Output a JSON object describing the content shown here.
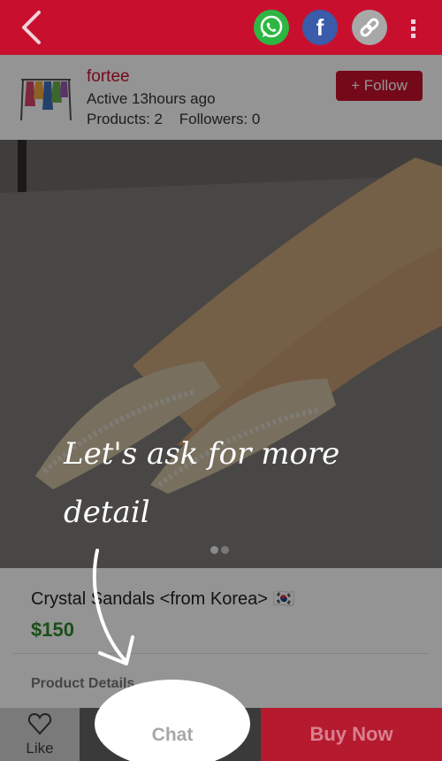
{
  "topbar": {
    "icons": [
      "back-icon",
      "whatsapp-icon",
      "facebook-icon",
      "link-icon",
      "more-vertical-icon"
    ],
    "facebook_glyph": "f"
  },
  "seller": {
    "name": "fortee",
    "active": "Active 13hours ago",
    "products": "Products: 2",
    "followers": "Followers: 0",
    "follow_label": "+ Follow"
  },
  "product": {
    "image_pages": 2,
    "current_page": 1,
    "title": "Crystal Sandals <from Korea> 🇰🇷",
    "price": "$150",
    "details_label": "Product Details"
  },
  "coach_mark": {
    "line1": "Let's ask for more",
    "line2": "detail"
  },
  "bottombar": {
    "like_label": "Like",
    "chat_label": "Chat",
    "buy_label": "Buy Now"
  },
  "colors": {
    "brand": "#c8102e",
    "price": "#2e8b2e"
  }
}
